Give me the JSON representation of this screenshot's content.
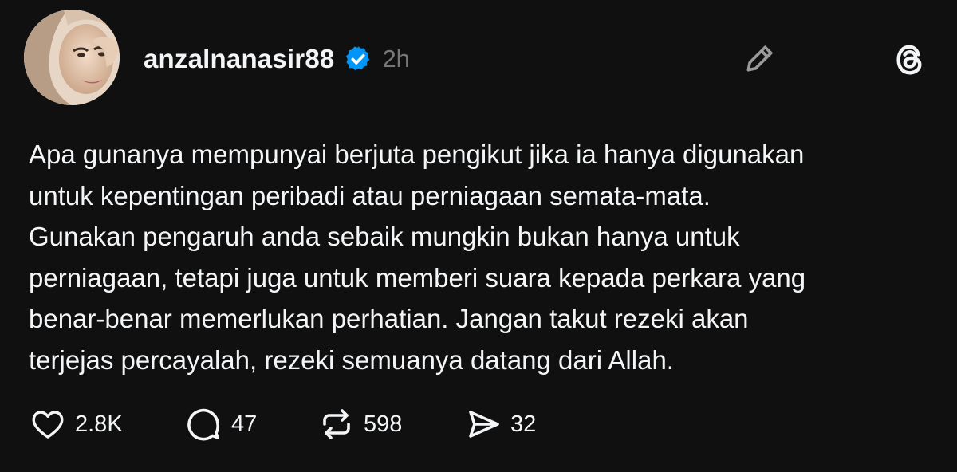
{
  "post": {
    "username": "anzalnanasir88",
    "time": "2h",
    "lines": [
      "Apa gunanya mempunyai berjuta pengikut jika ia hanya digunakan",
      "untuk kepentingan peribadi atau perniagaan semata-mata.",
      "Gunakan pengaruh anda sebaik mungkin bukan hanya untuk",
      "perniagaan, tetapi juga untuk memberi suara kepada perkara yang",
      "benar-benar memerlukan perhatian. Jangan takut rezeki akan",
      "terjejas percayalah, rezeki semuanya datang dari Allah."
    ]
  },
  "actions": {
    "likes": "2.8K",
    "replies": "47",
    "reposts": "598",
    "shares": "32"
  },
  "icons": {
    "verified": "verified-badge-icon",
    "edit": "pencil-icon",
    "threads": "threads-logo-icon",
    "like": "heart-icon",
    "reply": "speech-bubble-icon",
    "repost": "repost-icon",
    "share": "send-icon"
  },
  "colors": {
    "background": "#101010",
    "text": "#f3f5f7",
    "muted": "#777777",
    "verified": "#0095f6"
  }
}
